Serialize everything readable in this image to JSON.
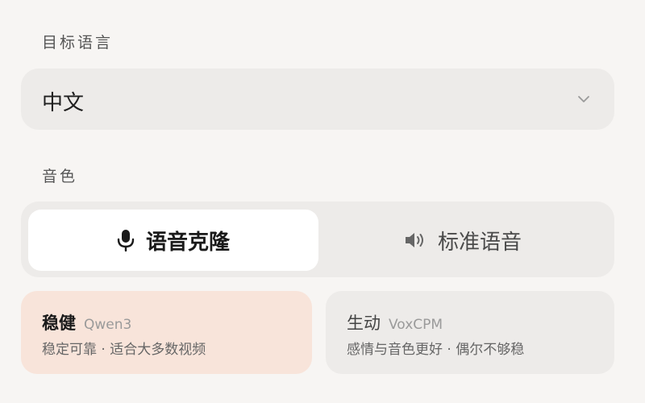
{
  "target_language": {
    "label": "目标语言",
    "selected": "中文"
  },
  "voice": {
    "label": "音色",
    "modes": [
      {
        "label": "语音克隆",
        "icon": "microphone-icon",
        "active": true
      },
      {
        "label": "标准语音",
        "icon": "speaker-icon",
        "active": false
      }
    ]
  },
  "engines": [
    {
      "title": "稳健",
      "model": "Qwen3",
      "desc": "稳定可靠 · 适合大多数视频",
      "selected": true
    },
    {
      "title": "生动",
      "model": "VoxCPM",
      "desc": "感情与音色更好 · 偶尔不够稳",
      "selected": false
    }
  ],
  "colors": {
    "background": "#f7f5f3",
    "panel": "#edebe9",
    "active_segment": "#ffffff",
    "selected_card": "#f8e4da"
  }
}
